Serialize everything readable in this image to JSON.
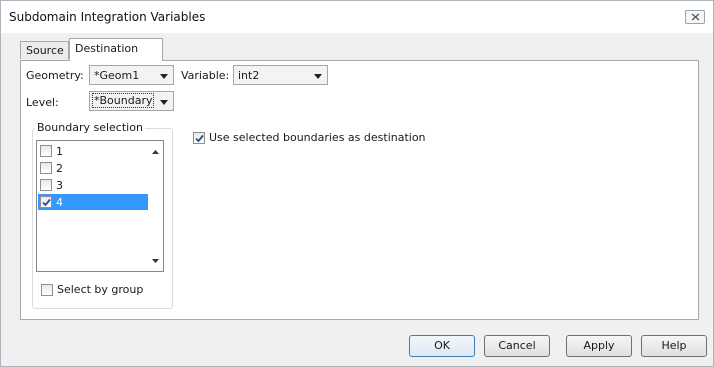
{
  "window": {
    "title": "Subdomain Integration Variables"
  },
  "tabs": [
    {
      "label": "Source",
      "active": false
    },
    {
      "label": "Destination",
      "active": true
    }
  ],
  "form": {
    "geometry_label": "Geometry:",
    "geometry_value": "*Geom1",
    "variable_label": "Variable:",
    "variable_value": "int2",
    "level_label": "Level:",
    "level_value": "*Boundary"
  },
  "boundary_selection": {
    "title": "Boundary selection",
    "items": [
      {
        "label": "1",
        "checked": false,
        "selected": false
      },
      {
        "label": "2",
        "checked": false,
        "selected": false
      },
      {
        "label": "3",
        "checked": false,
        "selected": false
      },
      {
        "label": "4",
        "checked": true,
        "selected": true
      }
    ],
    "select_by_group_label": "Select by group",
    "select_by_group_checked": false
  },
  "use_selected": {
    "label": "Use selected boundaries as destination",
    "checked": true
  },
  "buttons": {
    "ok": "OK",
    "cancel": "Cancel",
    "apply": "Apply",
    "help": "Help"
  },
  "icons": {
    "close": "close-icon",
    "dropdown": "chevron-down-icon",
    "scroll_up": "scroll-up-arrow-icon",
    "scroll_down": "scroll-down-arrow-icon",
    "check": "checkmark-icon"
  },
  "colors": {
    "selection": "#3399ff",
    "ok_border": "#3c7fb1"
  }
}
